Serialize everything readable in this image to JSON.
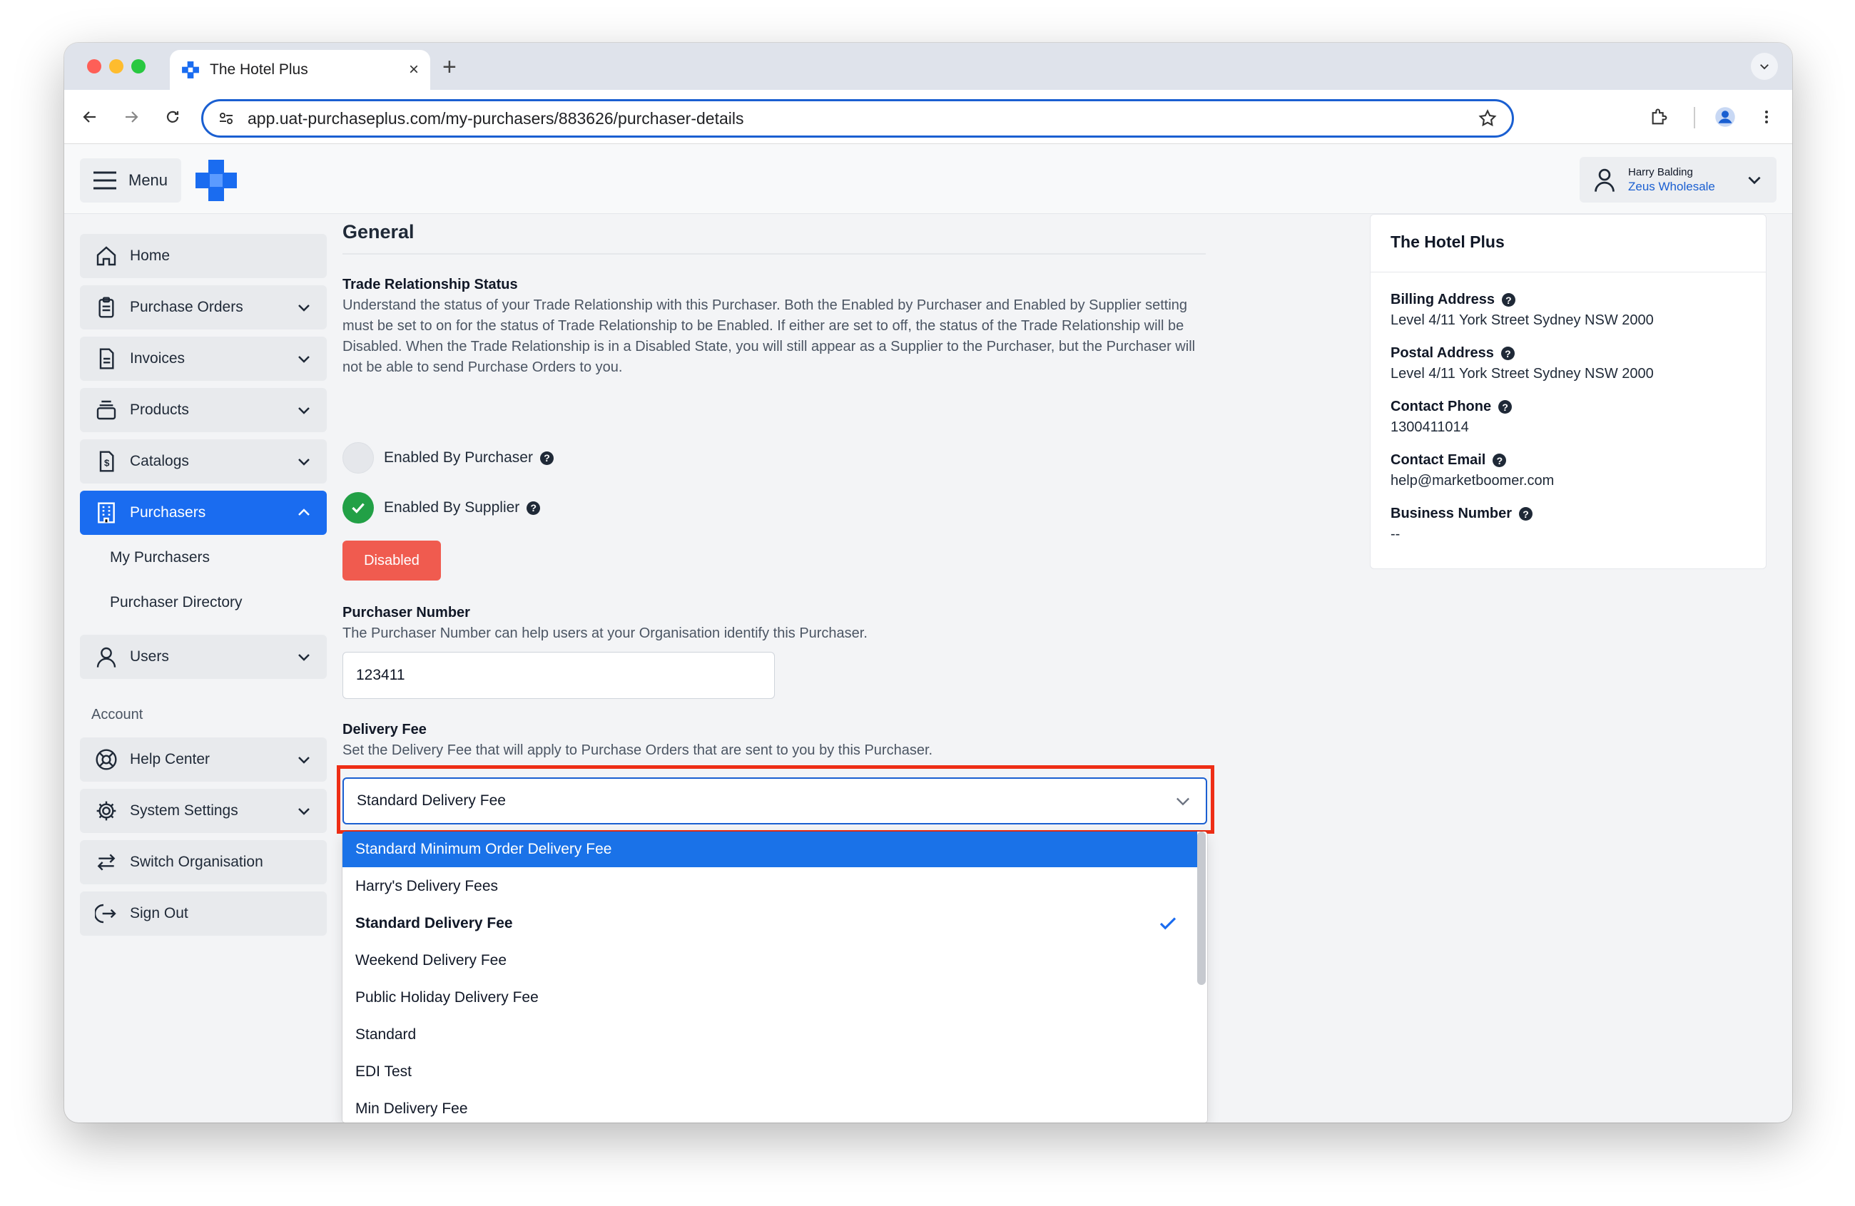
{
  "browser": {
    "tab_title": "The Hotel Plus",
    "new_tab": "+",
    "close": "×",
    "url": "app.uat-purchaseplus.com/my-purchasers/883626/purchaser-details"
  },
  "header": {
    "menu_label": "Menu",
    "user_name": "Harry Balding",
    "user_org": "Zeus Wholesale"
  },
  "sidebar": {
    "items": [
      {
        "label": "Home",
        "icon": "home-icon"
      },
      {
        "label": "Purchase Orders",
        "icon": "clipboard-icon"
      },
      {
        "label": "Invoices",
        "icon": "invoice-icon"
      },
      {
        "label": "Products",
        "icon": "products-icon"
      },
      {
        "label": "Catalogs",
        "icon": "catalog-icon"
      },
      {
        "label": "Purchasers",
        "icon": "building-icon"
      },
      {
        "label": "Users",
        "icon": "user-icon"
      }
    ],
    "sub_items": [
      "My Purchasers",
      "Purchaser Directory"
    ],
    "account_heading": "Account",
    "account_items": [
      {
        "label": "Help Center",
        "icon": "lifebuoy-icon"
      },
      {
        "label": "System Settings",
        "icon": "gear-icon"
      },
      {
        "label": "Switch Organisation",
        "icon": "switch-icon"
      },
      {
        "label": "Sign Out",
        "icon": "sign-out-icon"
      }
    ]
  },
  "main": {
    "section_title": "General",
    "trade": {
      "title": "Trade Relationship Status",
      "description": "Understand the status of your Trade Relationship with this Purchaser. Both the Enabled by Purchaser and Enabled by Supplier setting must be set to on for the status of Trade Relationship to be Enabled. If either are set to off, the status of the Trade Relationship will be Disabled. When the Trade Relationship is in a Disabled State, you will still appear as a Supplier to the Purchaser, but the Purchaser will not be able to send Purchase Orders to you.",
      "enabled_by_purchaser": "Enabled By Purchaser",
      "enabled_by_supplier": "Enabled By Supplier",
      "status_label": "Disabled"
    },
    "purchaser_number": {
      "title": "Purchaser Number",
      "description": "The Purchaser Number can help users at your Organisation identify this Purchaser.",
      "value": "123411"
    },
    "delivery_fee": {
      "title": "Delivery Fee",
      "description": "Set the Delivery Fee that will apply to Purchase Orders that are sent to you by this Purchaser.",
      "selected": "Standard Delivery Fee",
      "options": [
        "Standard Minimum Order Delivery Fee",
        "Harry's Delivery Fees",
        "Standard Delivery Fee",
        "Weekend Delivery Fee",
        "Public Holiday Delivery Fee",
        "Standard",
        "EDI Test",
        "Min Delivery Fee"
      ]
    }
  },
  "card": {
    "title": "The Hotel Plus",
    "billing_label": "Billing Address",
    "billing_value": "Level 4/11 York Street Sydney NSW 2000",
    "postal_label": "Postal Address",
    "postal_value": "Level 4/11 York Street Sydney NSW 2000",
    "phone_label": "Contact Phone",
    "phone_value": "1300411014",
    "email_label": "Contact Email",
    "email_value": "help@marketboomer.com",
    "business_label": "Business Number",
    "business_value": "--"
  },
  "help_glyph": "?",
  "colors": {
    "primary": "#1a6cf0",
    "disabled_red": "#f05b4f",
    "highlight_red": "#ee2e16",
    "success_green": "#22a046"
  }
}
